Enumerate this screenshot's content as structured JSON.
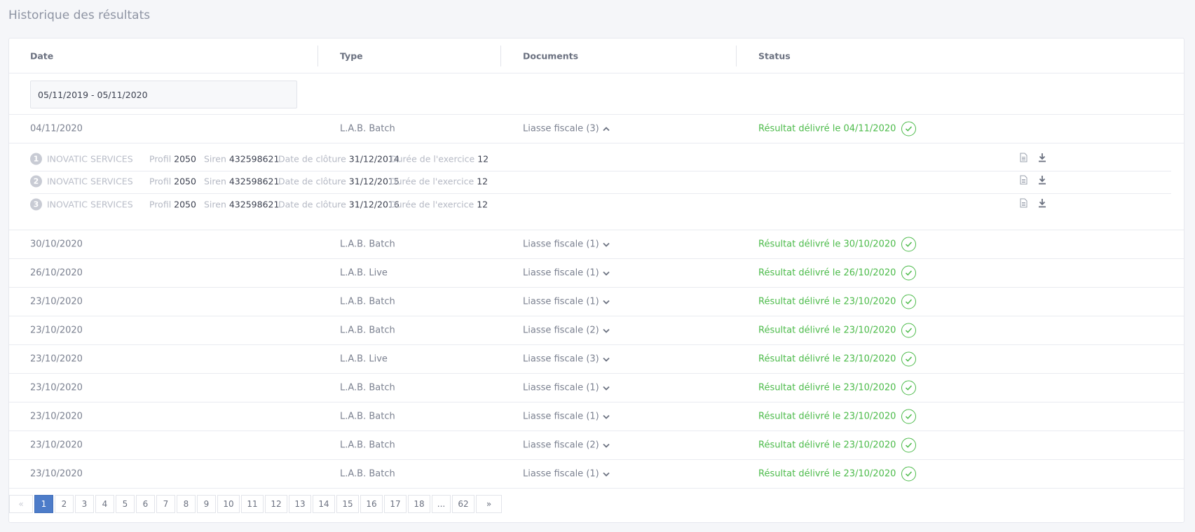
{
  "page": {
    "title": "Historique des résultats"
  },
  "table": {
    "headers": {
      "date": "Date",
      "type": "Type",
      "documents": "Documents",
      "status": "Status"
    },
    "filter": {
      "date_range": "05/11/2019 - 05/11/2020"
    },
    "expanded_row": {
      "date": "04/11/2020",
      "type": "L.A.B. Batch",
      "documents": "Liasse fiscale (3)",
      "status": "Résultat délivré le 04/11/2020"
    },
    "detail_labels": {
      "profil": "Profil",
      "siren": "Siren",
      "date_cloture": "Date de clôture",
      "duree": "Durée de l'exercice"
    },
    "details": [
      {
        "num": "1",
        "company": "INOVATIC SERVICES",
        "profil": "2050",
        "siren": "432598621",
        "date_cloture": "31/12/2014",
        "duree": "12"
      },
      {
        "num": "2",
        "company": "INOVATIC SERVICES",
        "profil": "2050",
        "siren": "432598621",
        "date_cloture": "31/12/2015",
        "duree": "12"
      },
      {
        "num": "3",
        "company": "INOVATIC SERVICES",
        "profil": "2050",
        "siren": "432598621",
        "date_cloture": "31/12/2016",
        "duree": "12"
      }
    ],
    "rows": [
      {
        "date": "30/10/2020",
        "type": "L.A.B. Batch",
        "documents": "Liasse fiscale (1)",
        "status": "Résultat délivré le 30/10/2020"
      },
      {
        "date": "26/10/2020",
        "type": "L.A.B. Live",
        "documents": "Liasse fiscale (1)",
        "status": "Résultat délivré le 26/10/2020"
      },
      {
        "date": "23/10/2020",
        "type": "L.A.B. Batch",
        "documents": "Liasse fiscale (1)",
        "status": "Résultat délivré le 23/10/2020"
      },
      {
        "date": "23/10/2020",
        "type": "L.A.B. Batch",
        "documents": "Liasse fiscale (2)",
        "status": "Résultat délivré le 23/10/2020"
      },
      {
        "date": "23/10/2020",
        "type": "L.A.B. Live",
        "documents": "Liasse fiscale (3)",
        "status": "Résultat délivré le 23/10/2020"
      },
      {
        "date": "23/10/2020",
        "type": "L.A.B. Batch",
        "documents": "Liasse fiscale (1)",
        "status": "Résultat délivré le 23/10/2020"
      },
      {
        "date": "23/10/2020",
        "type": "L.A.B. Batch",
        "documents": "Liasse fiscale (1)",
        "status": "Résultat délivré le 23/10/2020"
      },
      {
        "date": "23/10/2020",
        "type": "L.A.B. Batch",
        "documents": "Liasse fiscale (2)",
        "status": "Résultat délivré le 23/10/2020"
      },
      {
        "date": "23/10/2020",
        "type": "L.A.B. Batch",
        "documents": "Liasse fiscale (1)",
        "status": "Résultat délivré le 23/10/2020"
      }
    ]
  },
  "pagination": {
    "prev": "«",
    "pages": [
      "1",
      "2",
      "3",
      "4",
      "5",
      "6",
      "7",
      "8",
      "9",
      "10",
      "11",
      "12",
      "13",
      "14",
      "15",
      "16",
      "17",
      "18",
      "...",
      "62"
    ],
    "next": "»",
    "active": "1"
  },
  "icons": {
    "status": "check-circle-icon",
    "expand": "chevron-down-icon",
    "collapse": "chevron-up-icon",
    "document": "document-icon",
    "download": "download-icon"
  },
  "colors": {
    "success": "#4cbb4a",
    "accent": "#4d7cc9"
  }
}
